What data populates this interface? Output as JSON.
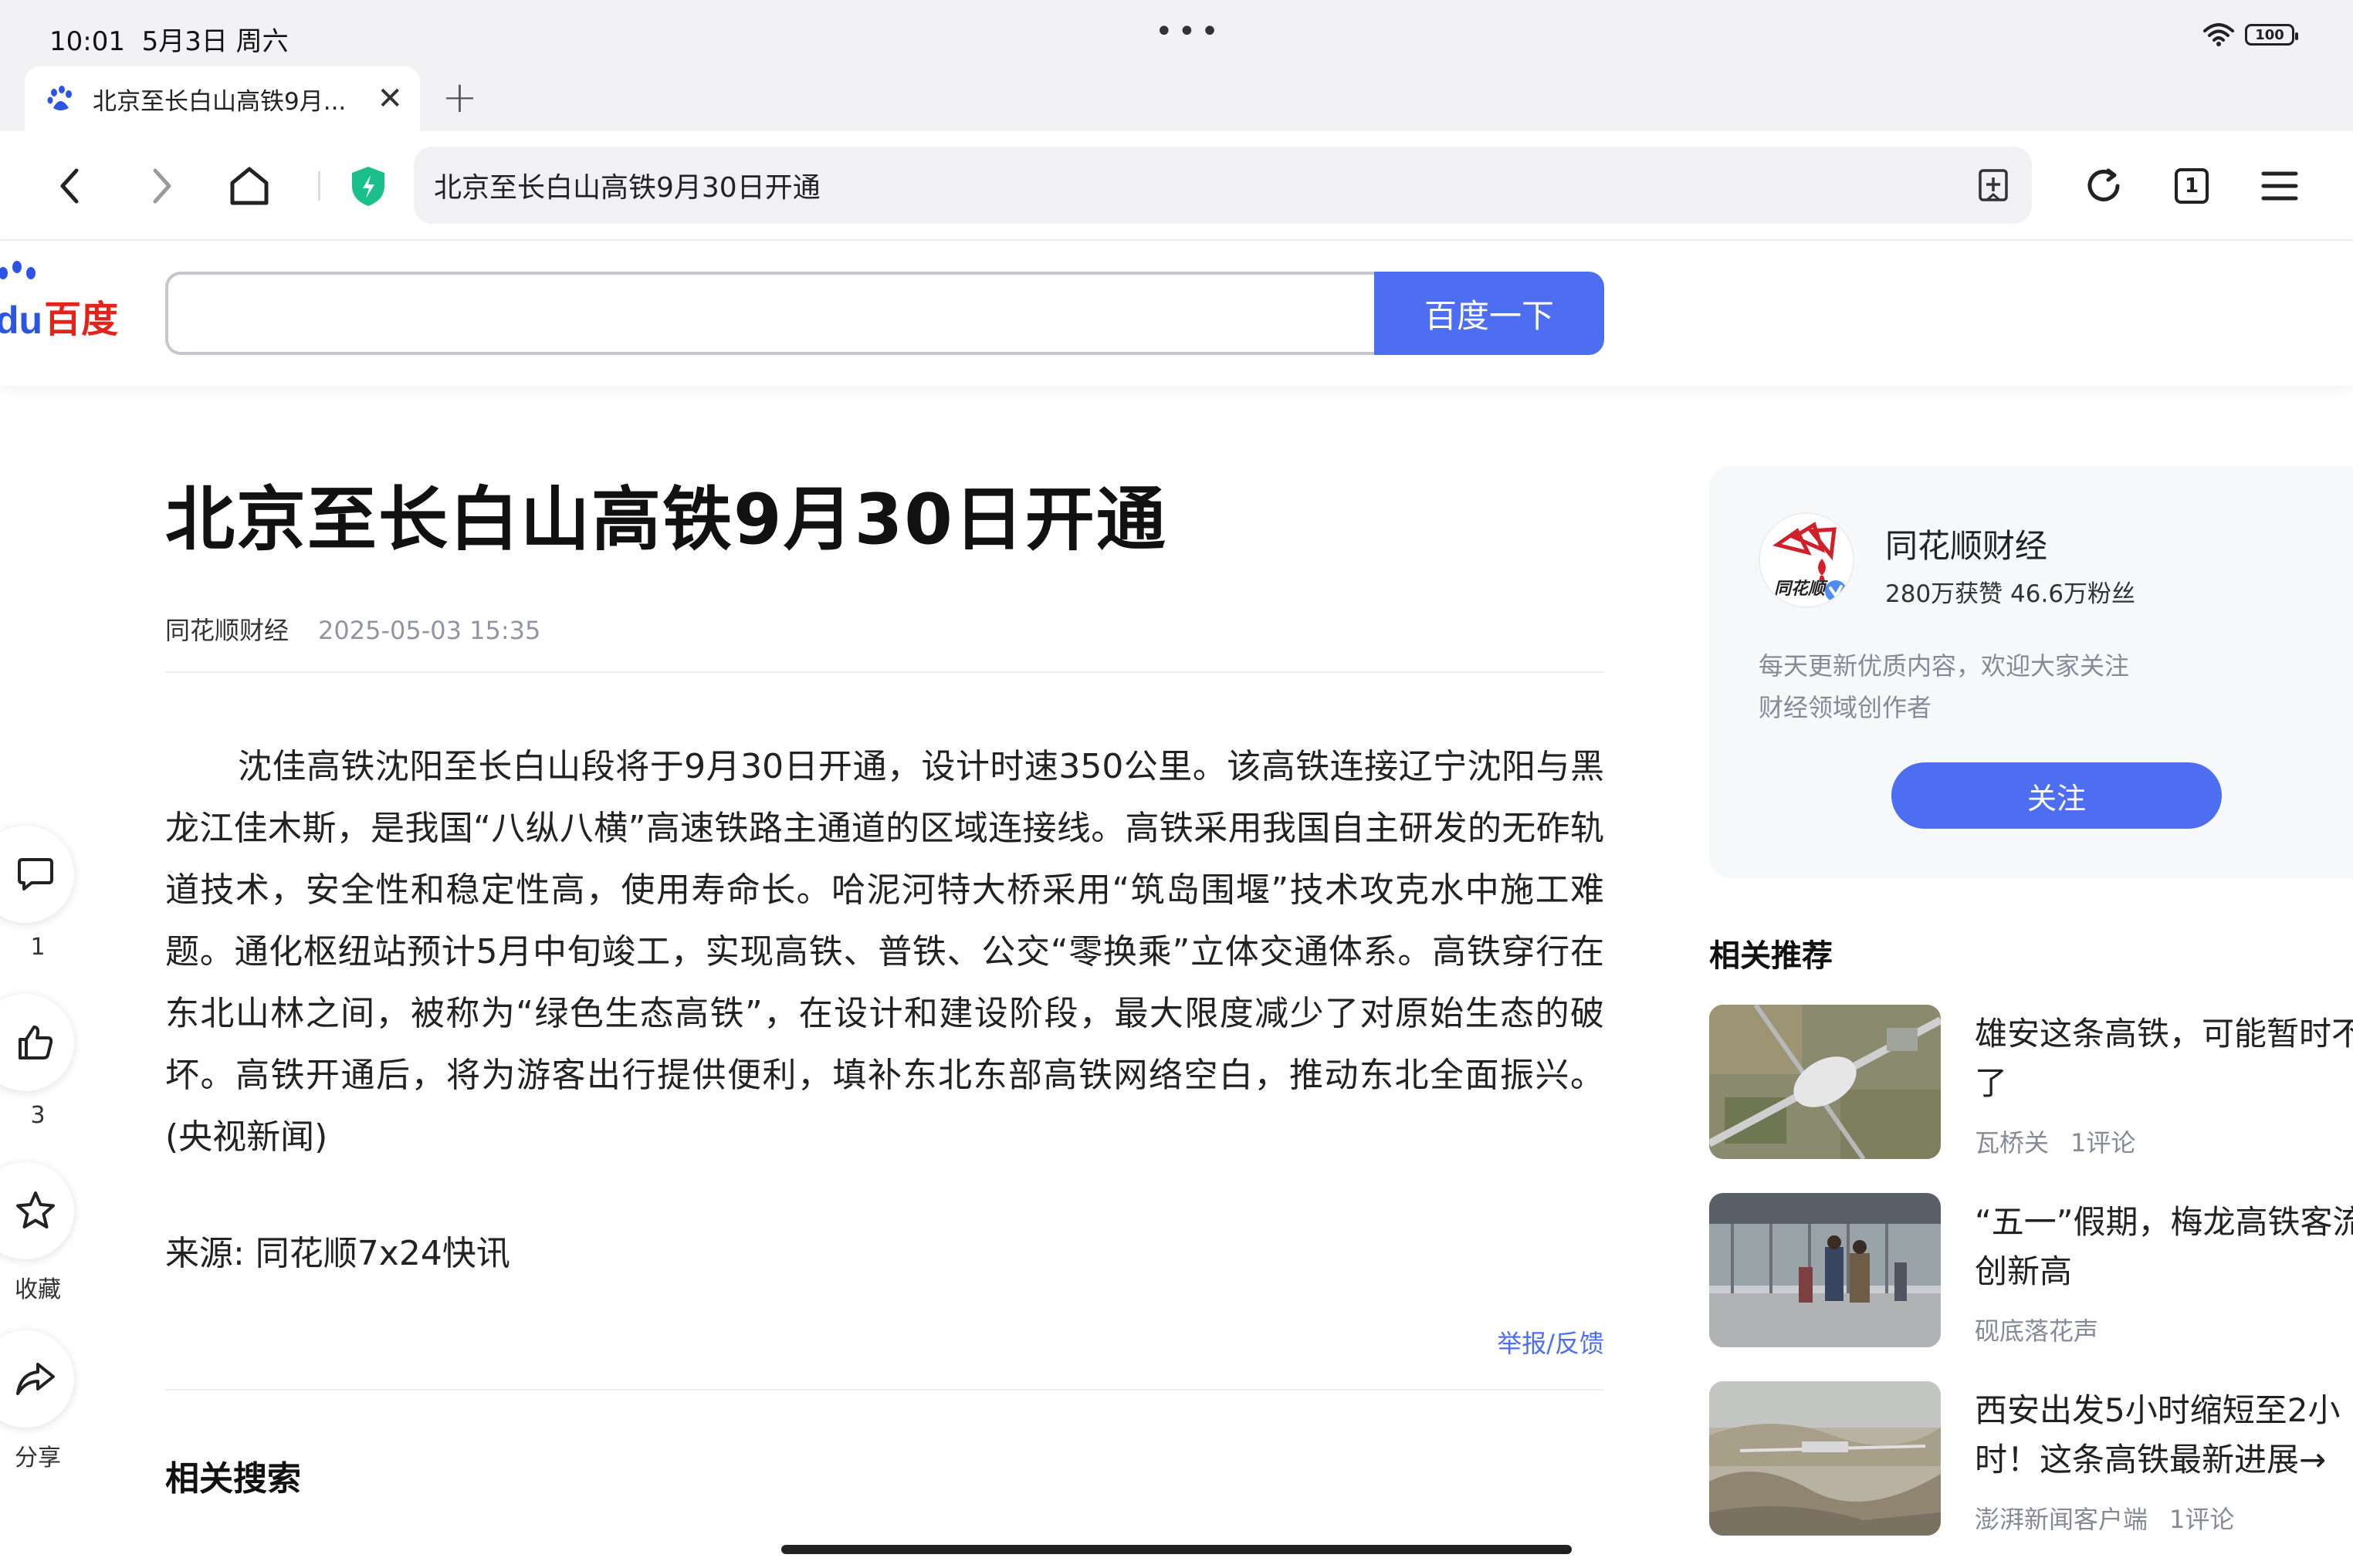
{
  "status_bar": {
    "time": "10:01",
    "date": "5月3日 周六",
    "battery": "100"
  },
  "tab": {
    "title": "北京至长白山高铁9月...",
    "close_glyph": "✕",
    "new_tab_glyph": "+"
  },
  "toolbar": {
    "address": "北京至长白山高铁9月30日开通",
    "tab_count": "1"
  },
  "baidu": {
    "logo_du": "du",
    "logo_cn": "百度",
    "search_value": "",
    "search_button": "百度一下"
  },
  "article": {
    "title": "北京至长白山高铁9月30日开通",
    "author": "同花顺财经",
    "time": "2025-05-03 15:35",
    "body": "沈佳高铁沈阳至长白山段将于9月30日开通，设计时速350公里。该高铁连接辽宁沈阳与黑龙江佳木斯，是我国“八纵八横”高速铁路主通道的区域连接线。高铁采用我国自主研发的无砟轨道技术，安全性和稳定性高，使用寿命长。哈泥河特大桥采用“筑岛围堰”技术攻克水中施工难题。通化枢纽站预计5月中旬竣工，实现高铁、普铁、公交“零换乘”立体交通体系。高铁穿行在东北山林之间，被称为“绿色生态高铁”，在设计和建设阶段，最大限度减少了对原始生态的破坏。高铁开通后，将为游客出行提供便利，填补东北东部高铁网络空白，推动东北全面振兴。(央视新闻)",
    "source": "来源: 同花顺7x24快讯",
    "report": "举报/反馈",
    "related_search": "相关搜索"
  },
  "rail": {
    "comment_count": "1",
    "like_count": "3",
    "favorite_label": "收藏",
    "share_label": "分享"
  },
  "author_card": {
    "name": "同花顺财经",
    "stats": "280万获赞 46.6万粉丝",
    "desc_line1": "每天更新优质内容，欢迎大家关注",
    "desc_line2": "财经领域创作者",
    "follow": "关注",
    "avatar_text": "同花顺"
  },
  "recommendations": {
    "heading": "相关推荐",
    "items": [
      {
        "title": "雄安这条高铁，可能暂时不\n了",
        "source": "瓦桥关",
        "comments": "1评论"
      },
      {
        "title": "“五一”假期，梅龙高铁客流\n创新高",
        "source": "砚底落花声",
        "comments": ""
      },
      {
        "title": "西安出发5小时缩短至2小\n时！这条高铁最新进展→",
        "source": "澎湃新闻客户端",
        "comments": "1评论"
      }
    ]
  },
  "colors": {
    "accent": "#4e6ef2",
    "baidu_red": "#e2231a",
    "baidu_blue": "#2b55e2",
    "shield": "#1bbf8a"
  },
  "icons": [
    "back-icon",
    "forward-icon",
    "home-icon",
    "shield-icon",
    "add-bookmark-icon",
    "refresh-icon",
    "menu-icon",
    "comment-icon",
    "like-icon",
    "star-icon",
    "share-icon",
    "wifi-icon",
    "baidu-paw-icon"
  ]
}
